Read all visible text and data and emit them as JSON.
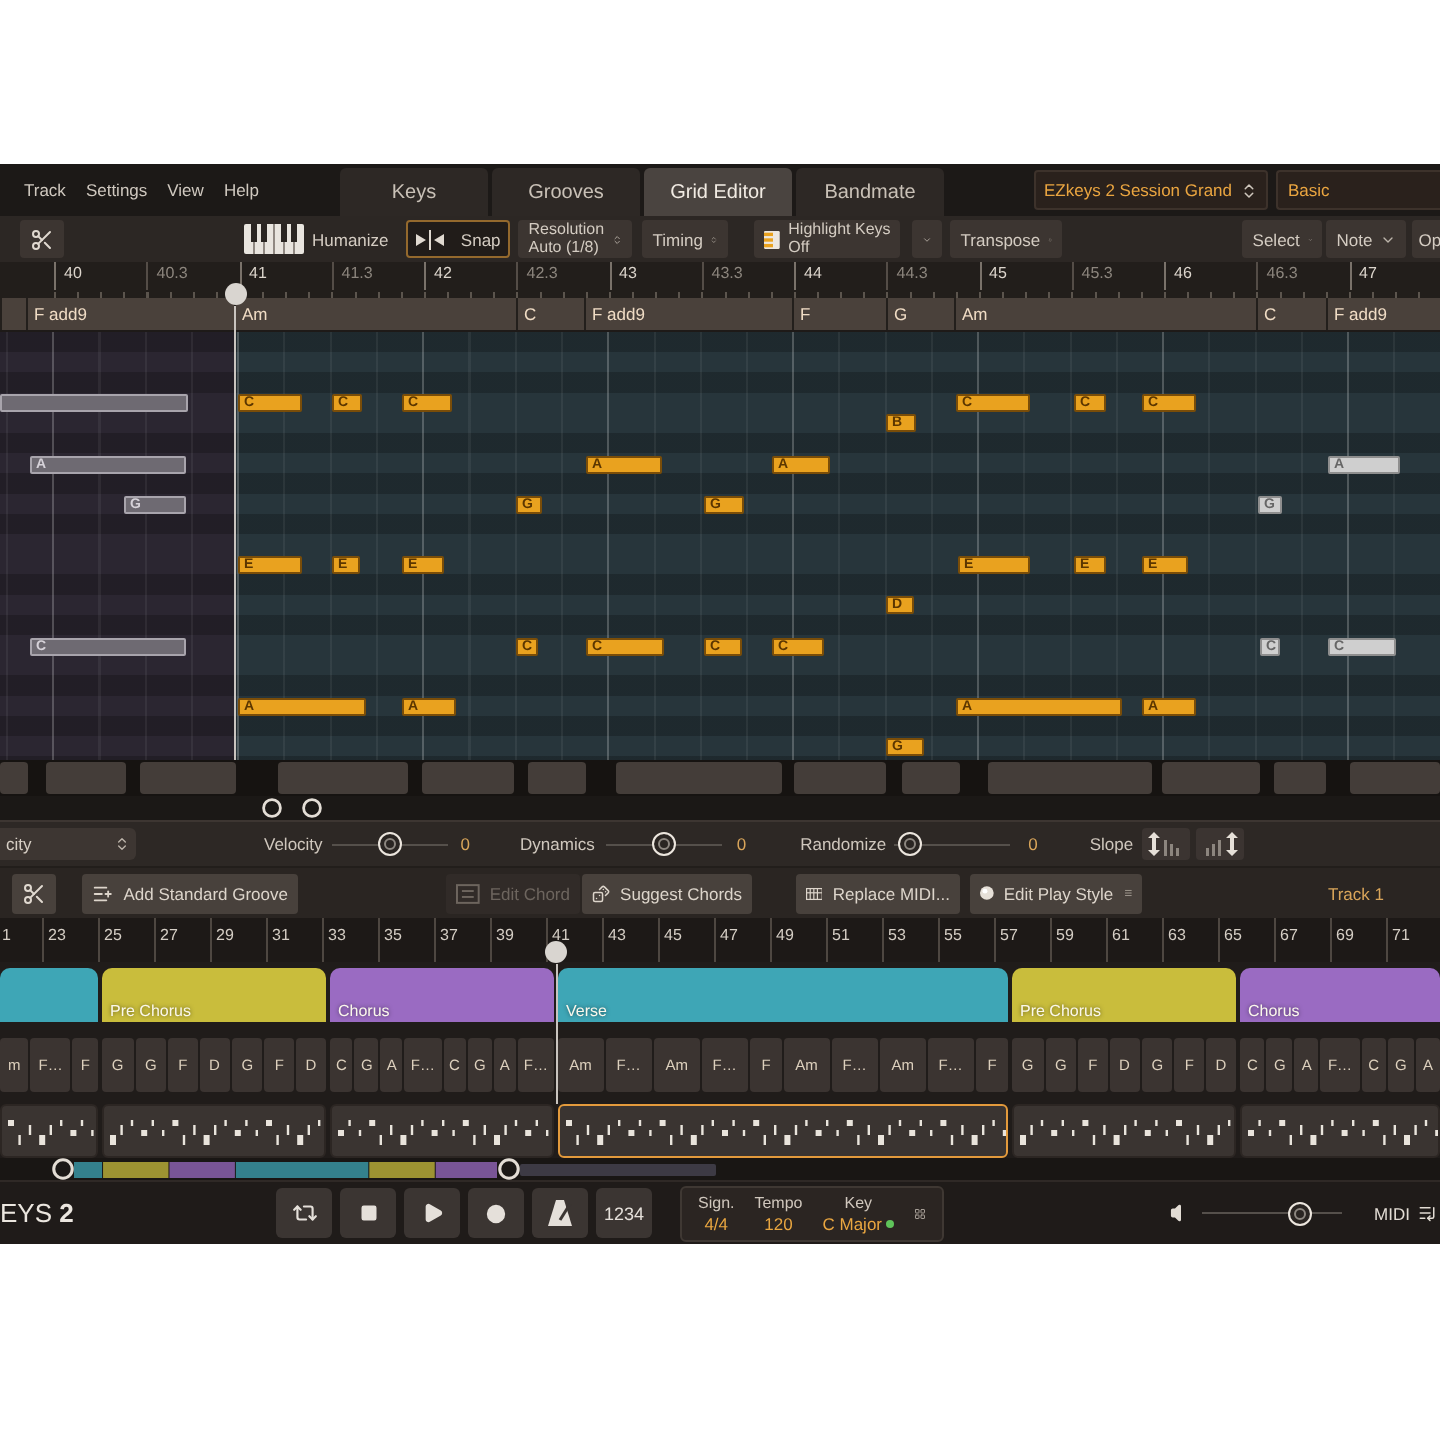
{
  "menu": [
    "Track",
    "Settings",
    "View",
    "Help"
  ],
  "tabs": [
    {
      "label": "Keys",
      "selected": false
    },
    {
      "label": "Grooves",
      "selected": false
    },
    {
      "label": "Grid Editor",
      "selected": true
    },
    {
      "label": "Bandmate",
      "selected": false
    }
  ],
  "instrument": "EZkeys 2 Session Grand",
  "preset": "Basic",
  "toolbar": {
    "humanize": "Humanize",
    "snap": {
      "label": "Snap",
      "on": true
    },
    "resolution": {
      "label": "Resolution",
      "value": "Auto (1/8)"
    },
    "timing": "Timing",
    "highlight_keys": {
      "label": "Highlight Keys",
      "value": "Off"
    },
    "transpose": "Transpose",
    "select": "Select",
    "note": "Note",
    "options": "Op"
  },
  "ruler": [
    {
      "label": "40",
      "kind": "bar"
    },
    {
      "label": "40.3",
      "kind": "beat"
    },
    {
      "label": "41",
      "kind": "bar"
    },
    {
      "label": "41.3",
      "kind": "beat"
    },
    {
      "label": "42",
      "kind": "bar"
    },
    {
      "label": "42.3",
      "kind": "beat"
    },
    {
      "label": "43",
      "kind": "bar"
    },
    {
      "label": "43.3",
      "kind": "beat"
    },
    {
      "label": "44",
      "kind": "bar"
    },
    {
      "label": "44.3",
      "kind": "beat"
    },
    {
      "label": "45",
      "kind": "bar"
    },
    {
      "label": "45.3",
      "kind": "beat"
    },
    {
      "label": "46",
      "kind": "bar"
    },
    {
      "label": "46.3",
      "kind": "beat"
    },
    {
      "label": "47",
      "kind": "bar"
    }
  ],
  "chords": [
    "F add9",
    "Am",
    "C",
    "F add9",
    "F",
    "G",
    "Am",
    "C",
    "F add9"
  ],
  "notes": [
    {
      "selected": false
    },
    {
      "label": "C",
      "selected": true
    },
    {
      "label": "C",
      "selected": true
    },
    {
      "label": "C",
      "selected": true
    },
    {
      "label": "C",
      "selected": true
    },
    {
      "label": "C",
      "selected": true
    },
    {
      "label": "C",
      "selected": true
    },
    {
      "label": "B",
      "selected": true
    },
    {
      "label": "A",
      "selected": false
    },
    {
      "label": "A",
      "selected": true
    },
    {
      "label": "A",
      "selected": true
    },
    {
      "label": "A",
      "selected": false
    },
    {
      "label": "G",
      "selected": false
    },
    {
      "label": "G",
      "selected": true
    },
    {
      "label": "G",
      "selected": true
    },
    {
      "label": "G",
      "selected": false
    },
    {
      "label": "E",
      "selected": true
    },
    {
      "label": "E",
      "selected": true
    },
    {
      "label": "E",
      "selected": true
    },
    {
      "label": "E",
      "selected": true
    },
    {
      "label": "E",
      "selected": true
    },
    {
      "label": "E",
      "selected": true
    },
    {
      "label": "D",
      "selected": true
    },
    {
      "label": "C",
      "selected": false
    },
    {
      "label": "C",
      "selected": true
    },
    {
      "label": "C",
      "selected": true
    },
    {
      "label": "C",
      "selected": true
    },
    {
      "label": "C",
      "selected": true
    },
    {
      "label": "C",
      "selected": false
    },
    {
      "label": "C",
      "selected": false
    },
    {
      "label": "A",
      "selected": true
    },
    {
      "label": "A",
      "selected": true
    },
    {
      "label": "A",
      "selected": true
    },
    {
      "label": "A",
      "selected": true
    },
    {
      "label": "G",
      "selected": true
    }
  ],
  "parameters": {
    "lane": "city",
    "sliders": [
      {
        "label": "Velocity",
        "level": 0.5,
        "reading": "0"
      },
      {
        "label": "Dynamics",
        "level": 0.5,
        "reading": "0"
      },
      {
        "label": "Randomize",
        "level": 0.05,
        "reading": "0"
      }
    ],
    "slope": "Slope"
  },
  "groove_bar": {
    "add_groove": "Add Standard Groove",
    "edit_chord": {
      "label": "Edit Chord",
      "disabled": true
    },
    "suggest_chords": {
      "label": "Suggest Chords",
      "disabled": false
    },
    "replace_midi": "Replace MIDI...",
    "edit_play_style": "Edit Play Style",
    "track": "Track 1"
  },
  "song_ruler": [
    "1",
    "23",
    "25",
    "27",
    "29",
    "31",
    "33",
    "35",
    "37",
    "39",
    "41",
    "43",
    "45",
    "47",
    "49",
    "51",
    "53",
    "55",
    "57",
    "59",
    "61",
    "63",
    "65",
    "67",
    "69",
    "71"
  ],
  "sections": [
    {
      "color": "#3ea6b6",
      "chords": [
        "m",
        "F…",
        "F"
      ],
      "selected": false
    },
    {
      "name": "Pre Chorus",
      "color": "#c9bd3c",
      "chords": [
        "G",
        "G",
        "F",
        "D",
        "G",
        "F",
        "D"
      ],
      "selected": false
    },
    {
      "name": "Chorus",
      "color": "#9a6bc2",
      "chords": [
        "C",
        "G",
        "A",
        "F…",
        "C",
        "G",
        "A",
        "F…"
      ],
      "selected": false
    },
    {
      "name": "Verse",
      "color": "#3ea6b6",
      "chords": [
        "Am",
        "F…",
        "Am",
        "F…",
        "F",
        "Am",
        "F…",
        "Am",
        "F…",
        "F"
      ],
      "selected": true
    },
    {
      "name": "Pre Chorus",
      "color": "#c9bd3c",
      "chords": [
        "G",
        "G",
        "F",
        "D",
        "G",
        "F",
        "D"
      ],
      "selected": false
    },
    {
      "name": "Chorus",
      "color": "#9a6bc2",
      "chords": [
        "C",
        "G",
        "A",
        "F…",
        "C",
        "G",
        "A"
      ],
      "selected": false
    }
  ],
  "transport": {
    "logo": "EYS **2**",
    "buttons": [
      {
        "kind": "loop"
      },
      {
        "kind": "stop"
      },
      {
        "kind": "play"
      },
      {
        "kind": "record"
      },
      {
        "kind": "metronome"
      },
      {
        "kind": "count_in",
        "label": "1234"
      }
    ],
    "signature": {
      "label": "Sign.",
      "value": "4/4"
    },
    "tempo": {
      "label": "Tempo",
      "value": "120"
    },
    "key": {
      "label": "Key",
      "value": "C Major"
    },
    "volume": {
      "level": 0.74
    },
    "midi": "MIDI"
  }
}
